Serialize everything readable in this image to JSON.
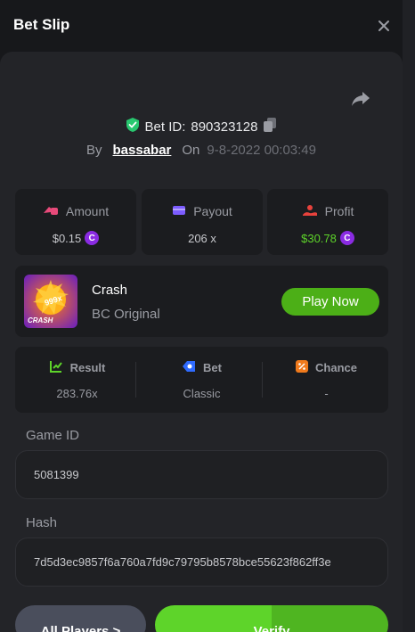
{
  "header": {
    "title": "Bet Slip",
    "close_icon": "close-icon"
  },
  "bet": {
    "id_prefix": "Bet ID:",
    "id_value": "890323128",
    "by_label": "By",
    "username": "bassabar",
    "on_label": "On",
    "timestamp": "9-8-2022 00:03:49",
    "verified_color": "#28c76f"
  },
  "stats": [
    {
      "label": "Amount",
      "value": "$0.15",
      "icon": "amount-icon",
      "color": "#e84a7a",
      "coin": true
    },
    {
      "label": "Payout",
      "value": "206 x",
      "icon": "wallet-icon",
      "color": "#7c5cff",
      "coin": false
    },
    {
      "label": "Profit",
      "value": "$30.78",
      "icon": "profit-icon",
      "color": "#e8423c",
      "coin": true
    }
  ],
  "game": {
    "name": "Crash",
    "provider": "BC Original",
    "thumb_text": "999x",
    "thumb_label": "CRASH",
    "play_label": "Play Now"
  },
  "details": [
    {
      "label": "Result",
      "value": "283.76x",
      "icon": "result-icon",
      "color": "#5ed42a"
    },
    {
      "label": "Bet",
      "value": "Classic",
      "icon": "bet-icon",
      "color": "#2f6bff"
    },
    {
      "label": "Chance",
      "value": "-",
      "icon": "chance-icon",
      "color": "#f07a1c"
    }
  ],
  "game_id": {
    "label": "Game ID",
    "value": "5081399"
  },
  "hash": {
    "label": "Hash",
    "value": "7d5d3ec9857f6a760a7fd9c79795b8578bce55623f862ff3e"
  },
  "actions": {
    "all_players": "All Players",
    "all_players_chevron": ">",
    "verify": "Verify"
  },
  "colors": {
    "accent_green": "#5ed42a",
    "background": "#17181b",
    "card": "#1b1c1f"
  }
}
